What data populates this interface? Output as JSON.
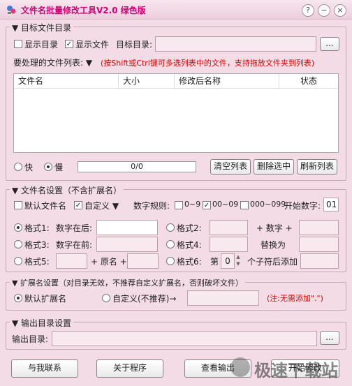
{
  "title": "文件名批量修改工具V2.0  绿色版",
  "window": {
    "help_glyph": "?",
    "minimize_glyph": "−",
    "close_glyph": "×"
  },
  "target": {
    "legend": "▼ 目标文件目录",
    "show_dir_label": "显示目录",
    "show_file_label": "显示文件",
    "dir_label": "目标目录:",
    "browse_label": "...",
    "list_label": "要处理的文件列表: ▼",
    "list_hint": "(按Shift或Ctrl键可多选列表中的文件，支持拖放文件夹到列表)",
    "columns": [
      "文件名",
      "大小",
      "修改后名称",
      "状态"
    ],
    "speed_fast": "快",
    "speed_slow": "慢",
    "progress_text": "0/0",
    "clear_label": "清空列表",
    "delete_label": "删除选中",
    "refresh_label": "刷新列表"
  },
  "name": {
    "legend": "▼ 文件名设置（不含扩展名）",
    "default_label": "默认文件名",
    "custom_label": "自定义 ▼",
    "rule_label": "数字规则:",
    "rule_0_9": "0~9",
    "rule_00_09": "00~09",
    "rule_000_099": "000~099",
    "start_label": "开始数字:",
    "start_value": "01",
    "fmt1": "格式1:",
    "num_after": "数字在后:",
    "fmt2": "格式2:",
    "plus_num": "+ 数字 +",
    "fmt3": "格式3:",
    "num_before": "数字在前:",
    "fmt4": "格式4:",
    "replace_label": "替换为",
    "fmt5": "格式5:",
    "plus_orig": "+ 原名 +",
    "fmt6": "格式6:",
    "nth_label": "第",
    "nth_value": "0",
    "after_char": "个子符后添加"
  },
  "ext": {
    "legend": "▼ 扩展名设置（对目录无效，不推荐自定义扩展名，否则破坏文件）",
    "default_label": "默认扩展名",
    "custom_label": "自定义(不推荐)→",
    "note": "(注:无需添加\".\")"
  },
  "output": {
    "legend": "▼ 输出目录设置",
    "dir_label": "输出目录:",
    "browse_label": "..."
  },
  "footer": {
    "contact_label": "与我联系",
    "about_label": "关于程序",
    "view_label": "查看输出",
    "start_label": "开始修改"
  },
  "watermark": "极速下载站"
}
